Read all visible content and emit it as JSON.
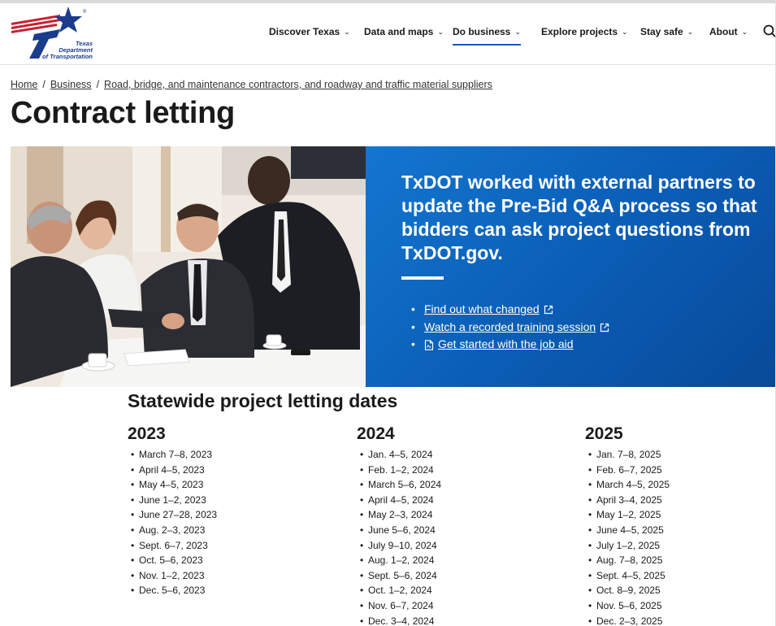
{
  "header": {
    "logo_text": [
      "Texas",
      "Department",
      "of Transportation"
    ],
    "nav": [
      {
        "label": "Discover Texas",
        "active": false
      },
      {
        "label": "Data and maps",
        "active": false
      },
      {
        "label": "Do business",
        "active": true
      },
      {
        "label": "Explore projects",
        "active": false
      },
      {
        "label": "Stay safe",
        "active": false
      },
      {
        "label": "About",
        "active": false
      }
    ],
    "search_icon": "search-icon"
  },
  "breadcrumb": [
    "Home",
    "Business",
    "Road, bridge, and maintenance contractors, and roadway and traffic material suppliers"
  ],
  "page_title": "Contract letting",
  "hero": {
    "heading": "TxDOT worked with external partners to update the Pre-Bid Q&A process so that bidders can ask project questions from TxDOT.gov.",
    "links": [
      {
        "label": "Find out what changed",
        "icon": "external-link-icon"
      },
      {
        "label": "Watch a recorded training session",
        "icon": "external-link-icon"
      },
      {
        "label": "Get started with the job aid",
        "icon": "pdf-document-icon"
      }
    ],
    "colors": {
      "panel": "#0a5cb4"
    }
  },
  "letting": {
    "title": "Statewide project letting dates",
    "years": [
      {
        "year": "2023",
        "dates": [
          "March 7–8, 2023",
          "April 4–5, 2023",
          "May 4–5, 2023",
          "June 1–2, 2023",
          "June 27–28, 2023",
          "Aug. 2–3, 2023",
          "Sept. 6–7, 2023",
          "Oct. 5–6, 2023",
          "Nov. 1–2, 2023",
          "Dec. 5–6, 2023"
        ]
      },
      {
        "year": "2024",
        "dates": [
          "Jan. 4–5, 2024",
          "Feb. 1–2, 2024",
          "March 5–6, 2024",
          "April 4–5, 2024",
          "May 2–3, 2024",
          "June 5–6, 2024",
          "July 9–10, 2024",
          "Aug. 1–2, 2024",
          "Sept. 5–6, 2024",
          "Oct. 1–2, 2024",
          "Nov. 6–7, 2024",
          "Dec. 3–4, 2024"
        ]
      },
      {
        "year": "2025",
        "dates": [
          "Jan. 7–8, 2025",
          "Feb. 6–7, 2025",
          "March 4–5, 2025",
          "April 3–4, 2025",
          "May 1–2, 2025",
          "June 4–5, 2025",
          "July 1–2, 2025",
          "Aug. 7–8, 2025",
          "Sept. 4–5, 2025",
          "Oct. 8–9, 2025",
          "Nov. 5–6, 2025",
          "Dec. 2–3, 2025"
        ]
      }
    ]
  }
}
